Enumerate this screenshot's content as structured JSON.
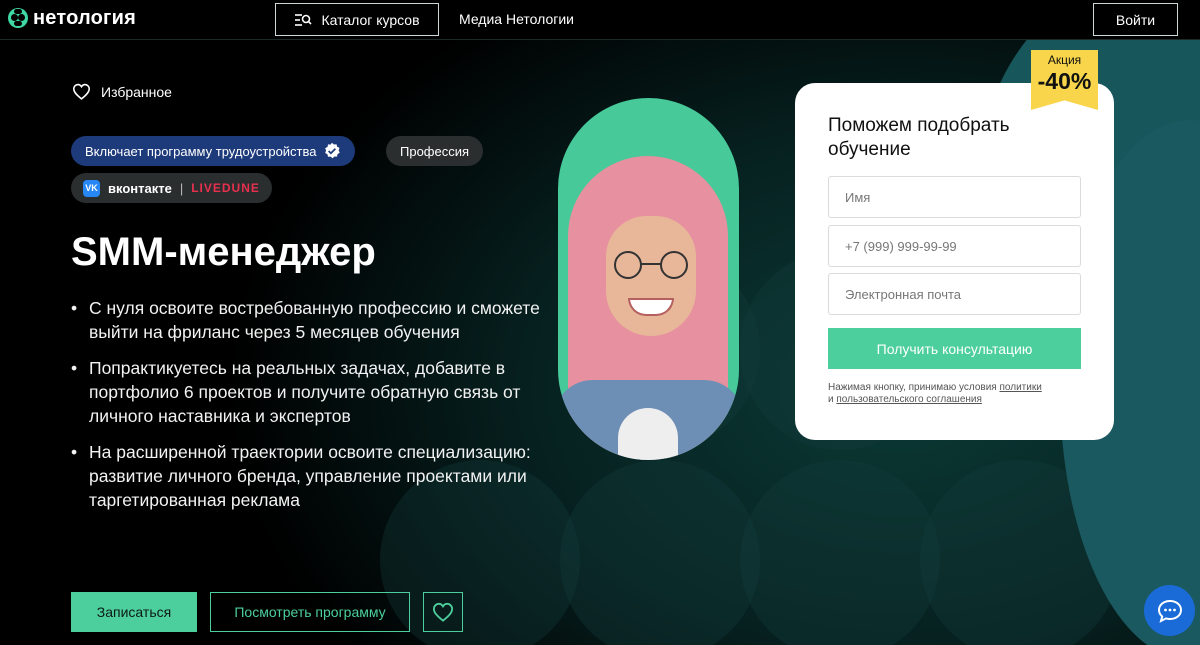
{
  "header": {
    "logo_text": "нетология",
    "catalog_label": "Каталог курсов",
    "media_label": "Медиа Нетологии",
    "login_label": "Войти"
  },
  "hero": {
    "favorites_label": "Избранное",
    "badge_employment": "Включает программу трудоустройства",
    "badge_profession": "Профессия",
    "partner_vk": "вконтакте",
    "partner_separator": "|",
    "partner_livedune": "LIVEDUNE",
    "title": "SMM-менеджер",
    "bullets": [
      "С нуля освоите востребованную профессию и сможете выйти на фриланс через 5 месяцев обучения",
      "Попрактикуетесь на реальных задачах, добавите в портфолио 6 проектов и получите обратную связь от личного наставника и экспертов",
      "На расширенной траектории освоите специализацию: развитие личного бренда, управление проектами или таргетированная реклама"
    ],
    "enroll_label": "Записаться",
    "program_label": "Посмотреть программу"
  },
  "form": {
    "title": "Поможем подобрать обучение",
    "name_placeholder": "Имя",
    "phone_placeholder": "+7 (999) 999-99-99",
    "email_placeholder": "Электронная почта",
    "submit_label": "Получить консультацию",
    "terms_prefix": "Нажимая кнопку, принимаю условия ",
    "terms_link1": "политики",
    "terms_and": "и ",
    "terms_link2": "пользовательского соглашения"
  },
  "promo": {
    "label": "Акция",
    "discount": "-40%"
  },
  "colors": {
    "accent": "#4ccf9c",
    "badge_blue": "#1d3a7a",
    "promo_yellow": "#f8d54a",
    "chat_blue": "#1a6bd8",
    "livedune_red": "#e8304e"
  },
  "icons": [
    "logo-icon",
    "catalog-search-icon",
    "heart-icon",
    "verified-icon",
    "vk-icon",
    "heart-outline-icon",
    "chat-icon"
  ]
}
